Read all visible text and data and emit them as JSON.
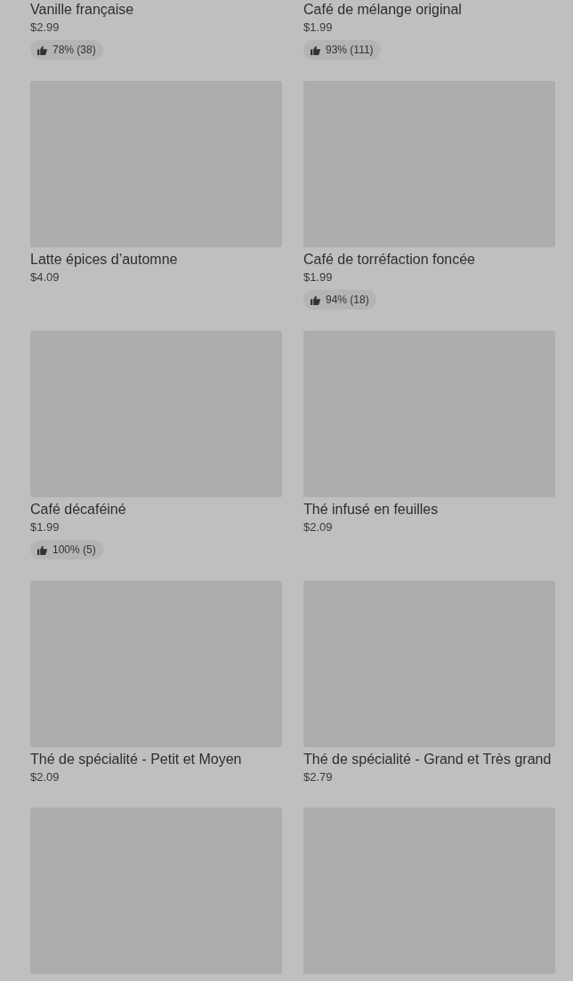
{
  "items": [
    {
      "picture": false,
      "title": "Vanille française",
      "price": "$2.99",
      "rating": "78% (38)"
    },
    {
      "picture": false,
      "title": "Café de mélange original",
      "price": "$1.99",
      "rating": "93% (111)"
    },
    {
      "picture": true,
      "title": "Latte épices d’automne",
      "price": "$4.09"
    },
    {
      "picture": true,
      "title": "Café de torréfaction foncée",
      "price": "$1.99",
      "rating": "94% (18)"
    },
    {
      "picture": true,
      "title": "Café décaféiné",
      "price": "$1.99",
      "rating": "100% (5)"
    },
    {
      "picture": true,
      "title": "Thé infusé en feuilles",
      "price": "$2.09"
    },
    {
      "picture": true,
      "title": "Thé de spécialité - Petit et Moyen",
      "price": "$2.09"
    },
    {
      "picture": true,
      "title": "Thé de spécialité - Grand et Très grand",
      "price": "$2.79"
    },
    {
      "picture": true
    },
    {
      "picture": true
    }
  ]
}
